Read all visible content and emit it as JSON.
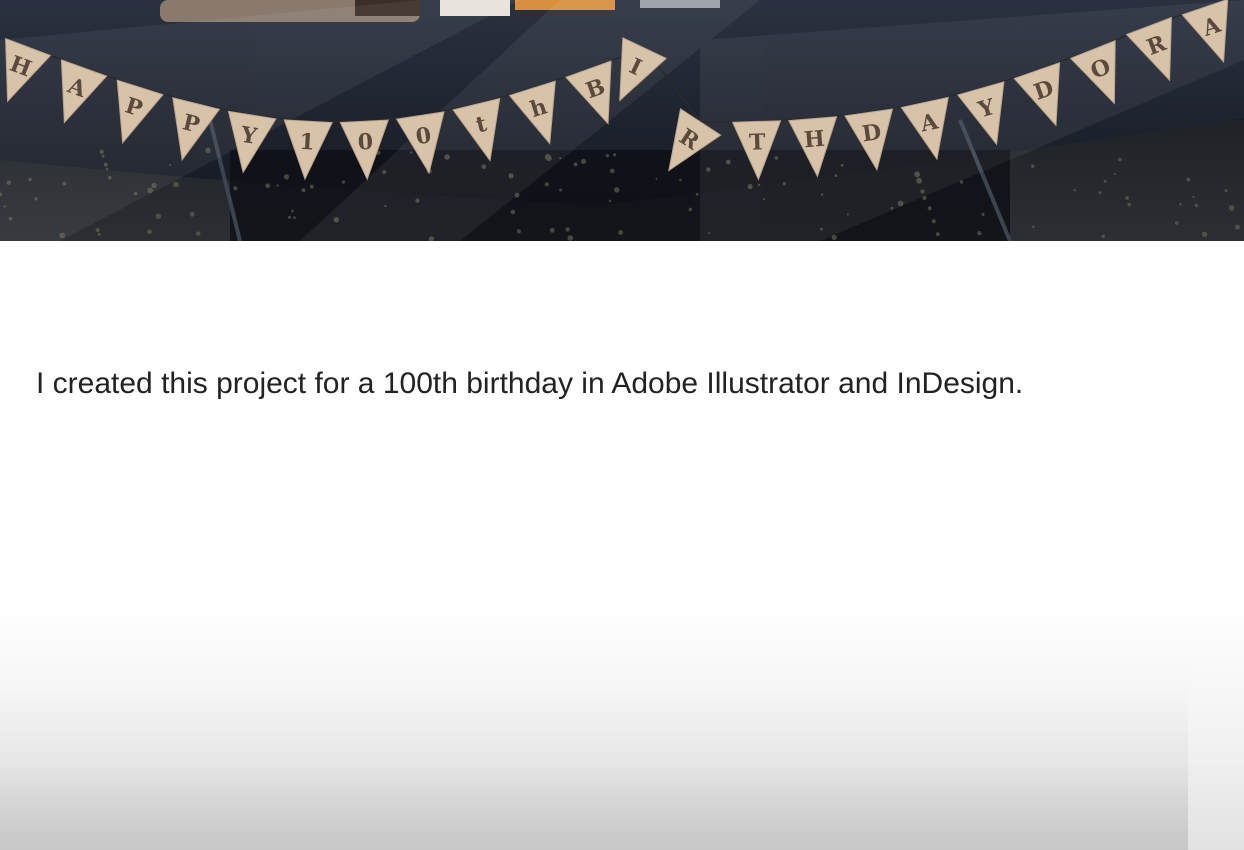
{
  "hero": {
    "image_name": "birthday-banner-photo",
    "banner_text": "HAPPY 100th BIRTHDAY DORA",
    "colors": {
      "tablecloth": "#1c2230",
      "pennant": "#d9c3a8",
      "lettering": "#5a4a3e",
      "floor": "#22262b"
    }
  },
  "description": {
    "text": "I created this project for a 100th birthday in Adobe Illustrator and InDesign."
  }
}
